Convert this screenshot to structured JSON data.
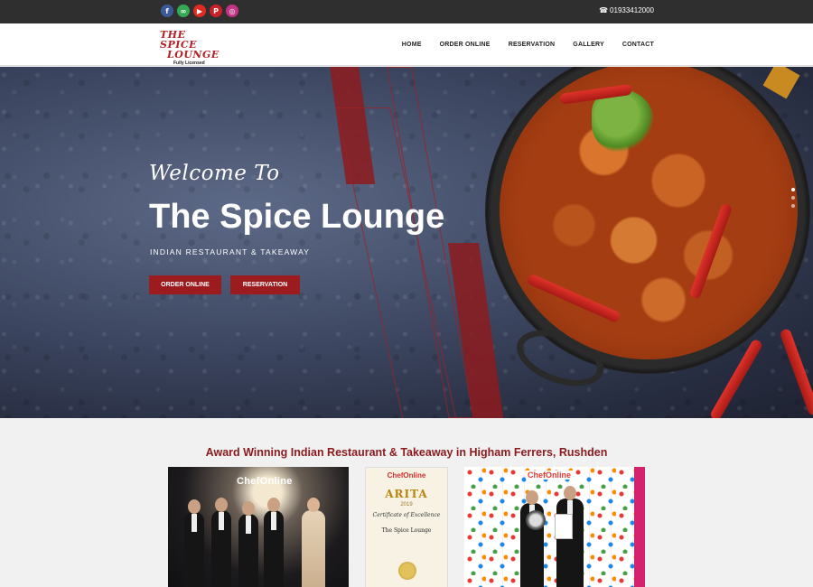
{
  "topbar": {
    "socials": [
      {
        "name": "facebook-icon",
        "glyph": "f",
        "color": "#3b5998"
      },
      {
        "name": "tripadvisor-icon",
        "glyph": "∞",
        "color": "#34a853"
      },
      {
        "name": "youtube-icon",
        "glyph": "▶",
        "color": "#e02a20"
      },
      {
        "name": "pinterest-icon",
        "glyph": "P",
        "color": "#cb2027"
      },
      {
        "name": "instagram-icon",
        "glyph": "◎",
        "color": "#c13584"
      }
    ],
    "phone_icon": "☎",
    "phone": "01933412000"
  },
  "header": {
    "logo_line1": "THE SPICE",
    "logo_line2": "LOUNGE",
    "logo_sub": "Fully Licensed",
    "nav": [
      "HOME",
      "ORDER ONLINE",
      "RESERVATION",
      "GALLERY",
      "CONTACT"
    ]
  },
  "hero": {
    "welcome": "Welcome To",
    "title": "The Spice Lounge",
    "subtitle": "INDIAN RESTAURANT & TAKEAWAY",
    "order_button": "ORDER ONLINE",
    "reservation_button": "RESERVATION",
    "slides": 3,
    "active_slide": 1
  },
  "awards": {
    "title": "Award Winning Indian Restaurant & Takeaway in Higham Ferrers, Rushden",
    "photo1_logo": "ChefOnline",
    "certificate": {
      "brand": "ChefOnline",
      "award": "ARITA",
      "year": "2019",
      "title": "Certificate of Excellence",
      "name": "The Spice Lounge"
    },
    "photo3_logo": "ChefOnline"
  },
  "colors": {
    "accent": "#9b1b1f",
    "topbar": "#2f2f2f",
    "title_red": "#8b1a1d"
  }
}
